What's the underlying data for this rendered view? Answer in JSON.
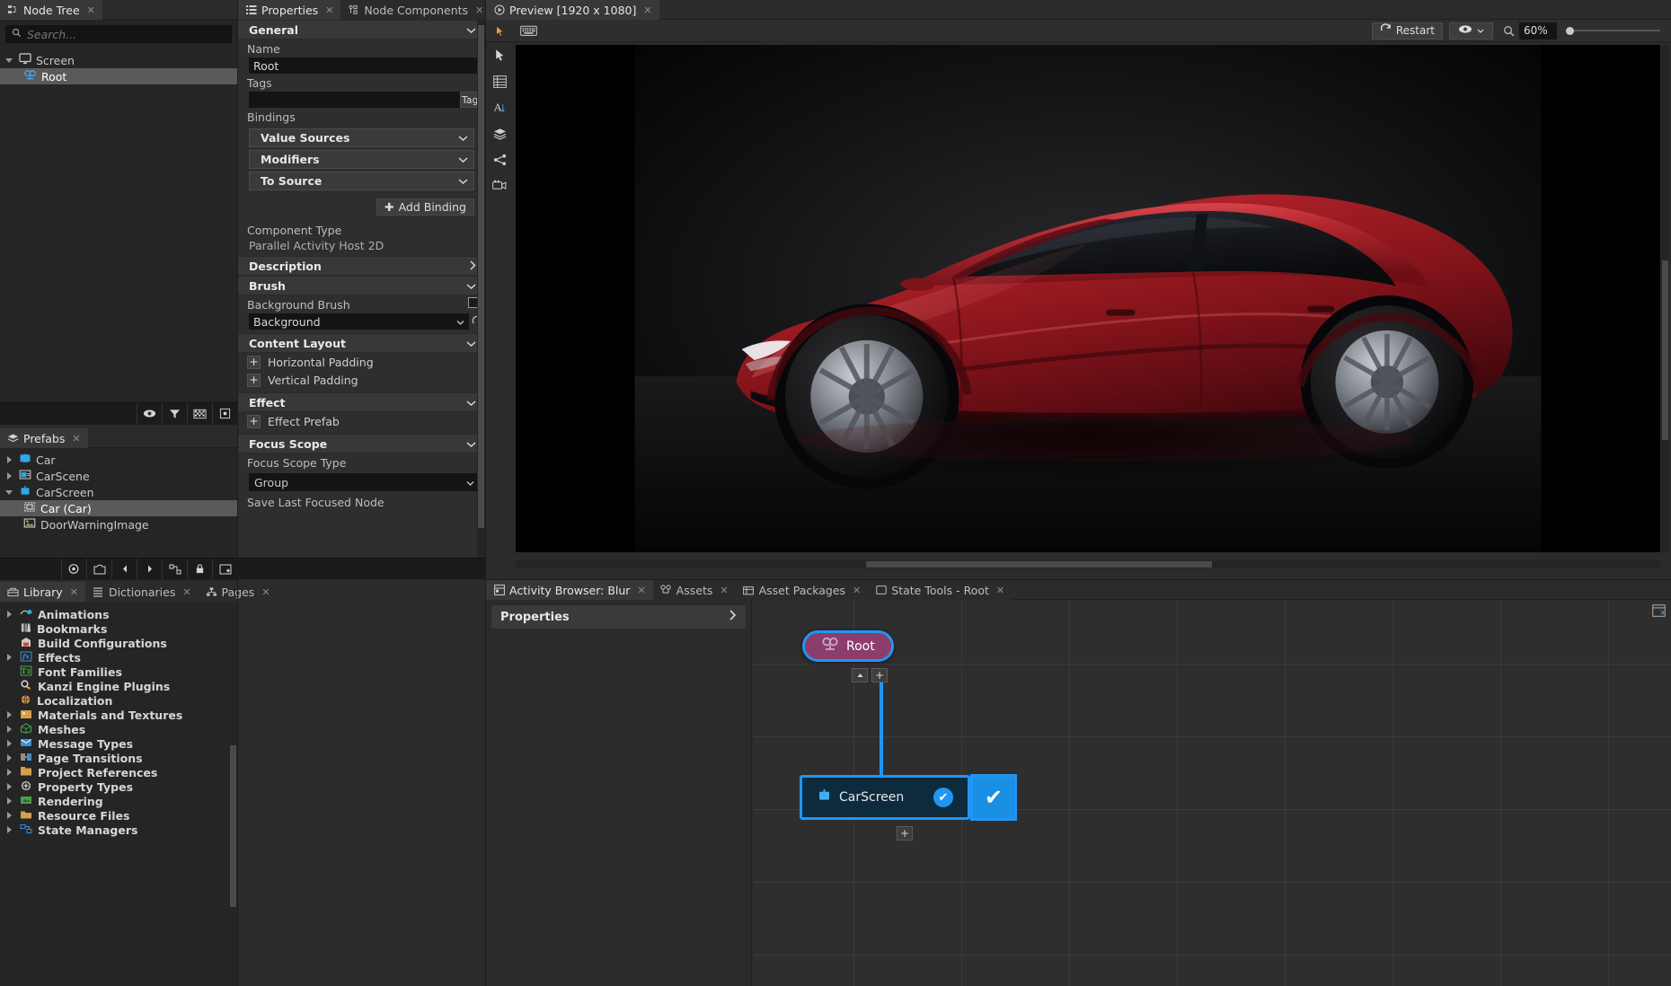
{
  "node_tree": {
    "tab": "Node Tree",
    "search_placeholder": "Search...",
    "items": [
      {
        "label": "Screen",
        "icon": "screen-icon",
        "depth": 0,
        "twisty": "open",
        "selected": false
      },
      {
        "label": "Root",
        "icon": "activity-host-icon",
        "depth": 1,
        "twisty": "none",
        "selected": true
      }
    ]
  },
  "prefabs": {
    "tab": "Prefabs",
    "items": [
      {
        "label": "Car",
        "icon": "prefab-icon",
        "depth": 0,
        "twisty": "closed",
        "selected": false
      },
      {
        "label": "CarScene",
        "icon": "scene-icon",
        "depth": 0,
        "twisty": "closed",
        "selected": false
      },
      {
        "label": "CarScreen",
        "icon": "screen-prefab-icon",
        "depth": 0,
        "twisty": "open",
        "selected": false
      },
      {
        "label": "Car (Car)",
        "icon": "instance-icon",
        "depth": 1,
        "twisty": "none",
        "selected": true
      },
      {
        "label": "DoorWarningImage",
        "icon": "image-icon",
        "depth": 1,
        "twisty": "none",
        "selected": false
      }
    ]
  },
  "library": {
    "tabs": [
      {
        "label": "Library",
        "icon": "library-icon",
        "active": true
      },
      {
        "label": "Dictionaries",
        "icon": "dictionary-icon",
        "active": false
      },
      {
        "label": "Pages",
        "icon": "pages-icon",
        "active": false
      }
    ],
    "items": [
      {
        "label": "Animations",
        "icon": "animation-icon",
        "twisty": "closed"
      },
      {
        "label": "Bookmarks",
        "icon": "bookmark-icon",
        "twisty": "none"
      },
      {
        "label": "Build Configurations",
        "icon": "build-icon",
        "twisty": "none"
      },
      {
        "label": "Effects",
        "icon": "fx-icon",
        "twisty": "closed"
      },
      {
        "label": "Font Families",
        "icon": "font-icon",
        "twisty": "none"
      },
      {
        "label": "Kanzi Engine Plugins",
        "icon": "plugin-icon",
        "twisty": "none"
      },
      {
        "label": "Localization",
        "icon": "globe-icon",
        "twisty": "none"
      },
      {
        "label": "Materials and Textures",
        "icon": "material-icon",
        "twisty": "closed"
      },
      {
        "label": "Meshes",
        "icon": "mesh-icon",
        "twisty": "closed"
      },
      {
        "label": "Message Types",
        "icon": "message-icon",
        "twisty": "closed"
      },
      {
        "label": "Page Transitions",
        "icon": "transition-icon",
        "twisty": "closed"
      },
      {
        "label": "Project References",
        "icon": "reference-icon",
        "twisty": "closed"
      },
      {
        "label": "Property Types",
        "icon": "property-icon",
        "twisty": "closed"
      },
      {
        "label": "Rendering",
        "icon": "rendering-icon",
        "twisty": "closed"
      },
      {
        "label": "Resource Files",
        "icon": "resource-icon",
        "twisty": "closed"
      },
      {
        "label": "State Managers",
        "icon": "state-manager-icon",
        "twisty": "closed"
      }
    ]
  },
  "properties": {
    "tabs": [
      {
        "label": "Properties",
        "icon": "properties-icon",
        "active": true
      },
      {
        "label": "Node Components",
        "icon": "components-icon",
        "active": false
      }
    ],
    "general_section": "General",
    "name_label": "Name",
    "name_value": "Root",
    "tags_label": "Tags",
    "tags_value": "",
    "tags_button": "Tags",
    "bindings_label": "Bindings",
    "binding_groups": [
      "Value Sources",
      "Modifiers",
      "To Source"
    ],
    "add_binding": "Add Binding",
    "component_type_label": "Component Type",
    "component_type_value": "Parallel Activity Host 2D",
    "description_section": "Description",
    "brush_section": "Brush",
    "background_brush_label": "Background Brush",
    "background_brush_value": "Background",
    "content_layout_section": "Content Layout",
    "horizontal_padding": "Horizontal Padding",
    "vertical_padding": "Vertical Padding",
    "effect_section": "Effect",
    "effect_prefab": "Effect Prefab",
    "focus_scope_section": "Focus Scope",
    "focus_scope_type_label": "Focus Scope Type",
    "focus_scope_type_value": "Group",
    "save_last_focused_node": "Save Last Focused Node"
  },
  "preview": {
    "tab": "Preview [1920 x 1080]",
    "restart_label": "Restart",
    "zoom_value": "60%",
    "tools": [
      {
        "name": "pointer-tool",
        "active": true
      },
      {
        "name": "keyboard-tool",
        "active": false
      }
    ],
    "side_tools": [
      {
        "name": "select-arrow-icon",
        "active": false
      },
      {
        "name": "grid-layout-icon",
        "active": false
      },
      {
        "name": "text-tool-icon",
        "active": false
      },
      {
        "name": "layers-icon",
        "active": false
      },
      {
        "name": "node-graph-icon",
        "active": false
      },
      {
        "name": "camera-icon",
        "active": false
      }
    ],
    "scene_description": "Red sports car rendered on dark background"
  },
  "bottom_dock": {
    "tabs": [
      {
        "label": "Activity Browser: Blur",
        "icon": "activity-browser-icon",
        "active": true
      },
      {
        "label": "Assets",
        "icon": "assets-icon",
        "active": false
      },
      {
        "label": "Asset Packages",
        "icon": "asset-packages-icon",
        "active": false
      },
      {
        "label": "State Tools - Root",
        "icon": "state-tools-icon",
        "active": false
      }
    ],
    "properties_header": "Properties",
    "graph": {
      "nodes": [
        {
          "id": "root",
          "label": "Root",
          "icon": "activity-host-icon",
          "type": "pill",
          "selected": true
        },
        {
          "id": "carscreen",
          "label": "CarScreen",
          "icon": "screen-prefab-icon",
          "type": "box",
          "checked": true
        }
      ],
      "add_buttons": [
        "+",
        "+"
      ]
    }
  },
  "colors": {
    "accent_blue": "#2196f3",
    "node_magenta": "#8d3d6b",
    "node_dark_blue": "#0e2a3d",
    "tree_selection": "#5a5a5a",
    "panel_bg": "#252525",
    "panel_alt_bg": "#2e2e2e",
    "section_bg": "#383838",
    "text": "#c8c8c8",
    "car_red": "#9e1f25"
  }
}
